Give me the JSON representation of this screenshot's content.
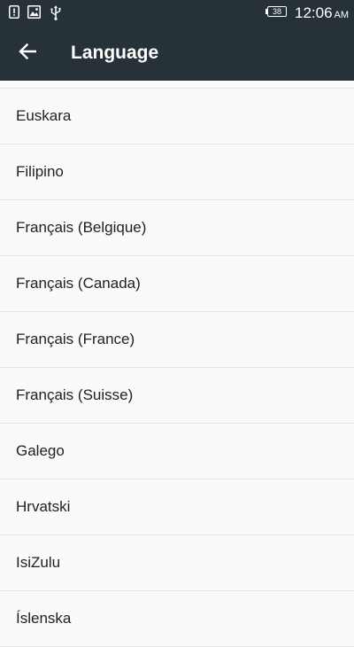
{
  "status_bar": {
    "icons": [
      "alert-icon",
      "image-icon",
      "usb-icon"
    ],
    "battery_level": "38",
    "time": "12:06",
    "ampm": "AM"
  },
  "app_bar": {
    "title": "Language",
    "back_icon": "arrow-left-icon"
  },
  "languages": [
    "Euskara",
    "Filipino",
    "Français (Belgique)",
    "Français (Canada)",
    "Français (France)",
    "Français (Suisse)",
    "Galego",
    "Hrvatski",
    "IsiZulu",
    "Íslenska"
  ],
  "colors": {
    "app_bar": "#263238",
    "background": "#fafafa",
    "text": "#212121",
    "divider": "#e6e6e6"
  }
}
